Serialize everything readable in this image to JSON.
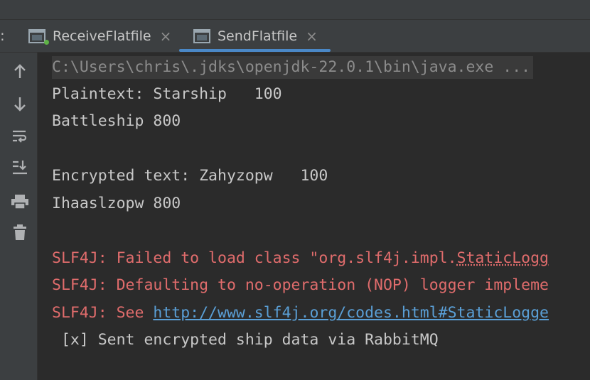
{
  "tabs": {
    "prefix": ":",
    "items": [
      {
        "label": "ReceiveFlatfile",
        "icon": "console-window-icon",
        "active": false
      },
      {
        "label": "SendFlatfile",
        "icon": "console-window-icon",
        "active": true
      }
    ],
    "close_glyph": "×"
  },
  "toolbar": {
    "items": [
      {
        "name": "scroll-up-icon"
      },
      {
        "name": "scroll-down-icon"
      },
      {
        "name": "soft-wrap-icon"
      },
      {
        "name": "scroll-to-end-icon"
      },
      {
        "name": "print-icon"
      },
      {
        "name": "clear-all-icon"
      }
    ]
  },
  "console": {
    "command": "C:\\Users\\chris\\.jdks\\openjdk-22.0.1\\bin\\java.exe ...",
    "plaintext_line1": "Plaintext: Starship   100",
    "plaintext_line2": "Battleship 800",
    "encrypted_line1": "Encrypted text: Zahyzopw   100",
    "encrypted_line2": "Ihaaslzopw 800",
    "slf4j_1_prefix": "SLF4J: Failed to load class \"org.slf4j.impl.",
    "slf4j_1_dotted": "StaticLogg",
    "slf4j_2": "SLF4J: Defaulting to no-operation (NOP) logger impleme",
    "slf4j_3_prefix": "SLF4J: See ",
    "slf4j_3_link": "http://www.slf4j.org/codes.html#StaticLogge",
    "sent_line": " [x] Sent encrypted ship data via RabbitMQ"
  },
  "colors": {
    "background": "#2b2b2b",
    "panel": "#3c3f41",
    "error_text": "#e06c6c",
    "link": "#5a9fd6",
    "tab_underline": "#4a88c7",
    "run_badge": "#5fb346"
  }
}
